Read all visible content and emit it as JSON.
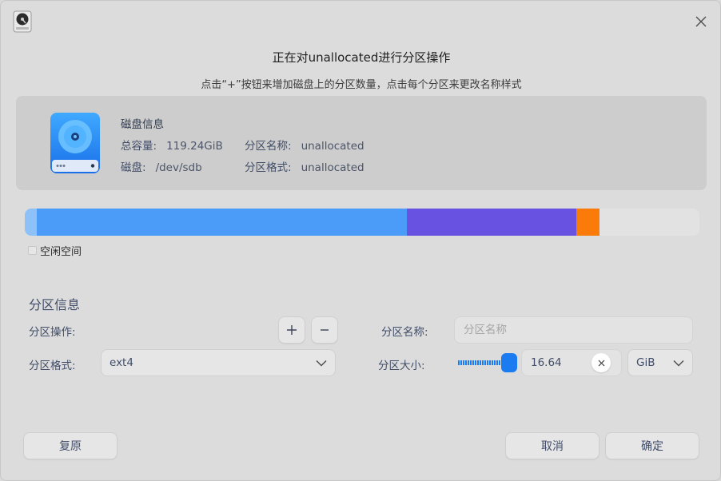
{
  "dialog": {
    "title": "正在对unallocated进行分区操作",
    "subtitle": "点击“+”按钮来增加磁盘上的分区数量，点击每个分区来更改名称样式"
  },
  "icons": {
    "app": "disk-utility-icon",
    "close": "close-icon",
    "disk": "hard-disk-icon",
    "plus": "plus-icon",
    "minus": "minus-icon",
    "chevron": "chevron-down-icon",
    "clear": "clear-icon"
  },
  "disk_info": {
    "heading": "磁盘信息",
    "capacity_label": "总容量:",
    "capacity_value": "119.24GiB",
    "disk_label": "磁盘:",
    "disk_value": "/dev/sdb",
    "part_name_label": "分区名称:",
    "part_name_value": "unallocated",
    "part_format_label": "分区格式:",
    "part_format_value": "unallocated"
  },
  "partition_bar": {
    "segments": [
      {
        "fraction": 0.018,
        "color": "#8ec1f8"
      },
      {
        "fraction": 0.548,
        "color": "#4a9cf8"
      },
      {
        "fraction": 0.251,
        "color": "#6752e2"
      },
      {
        "fraction": 0.035,
        "color": "#fa7a0a"
      },
      {
        "fraction": 0.148,
        "color": "#e2e2e2"
      }
    ]
  },
  "legend": {
    "free_space_label": "空闲空间"
  },
  "partition_info": {
    "section_title": "分区信息",
    "operation_label": "分区操作:",
    "name_label": "分区名称:",
    "name_placeholder": "分区名称",
    "name_value": "",
    "format_label": "分区格式:",
    "format_value": "ext4",
    "size_label": "分区大小:",
    "size_value": "16.64",
    "size_unit": "GiB"
  },
  "buttons": {
    "reset": "复原",
    "cancel": "取消",
    "ok": "确定"
  },
  "colors": {
    "accent": "#1a7cf0"
  }
}
